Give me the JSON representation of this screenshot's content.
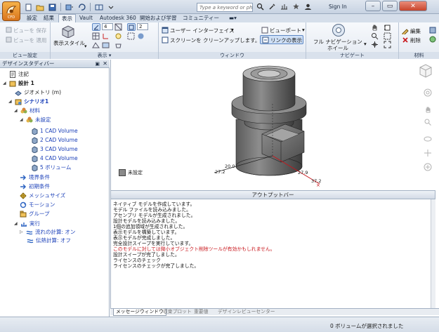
{
  "app": {
    "badge": "CFD",
    "search_placeholder": "Type a keyword or phrase",
    "signin": "Sign In",
    "window_controls": [
      "minimize",
      "maximize",
      "close"
    ]
  },
  "tabs": [
    "設定",
    "結果",
    "表示",
    "Vault",
    "Autodesk 360",
    "開始および学習",
    "コミュニティー"
  ],
  "active_tab": "表示",
  "ribbon": {
    "view_settings": {
      "label": "ビュー設定",
      "save_view": "ビューを 保存",
      "apply_view": "ビューを 適用"
    },
    "display": {
      "label": "表示",
      "display_style": "表示スタイル",
      "spin_value_1": "4",
      "spin_value_2": "2"
    },
    "window": {
      "label": "ウィンドウ",
      "user_interface": "ユーザー インターフェイス",
      "clean_screen": "スクリーンを クリーンアップします。",
      "viewport": "ビューポート",
      "link_display": "リンクの表示"
    },
    "navigate": {
      "label": "ナビゲート",
      "full_nav_wheel_line1": "フル ナビゲーション",
      "full_nav_wheel_line2": "ホイール"
    },
    "materials": {
      "label": "材料",
      "edit": "編集",
      "delete": "削除"
    }
  },
  "design_study_bar": {
    "title": "デザインスタディバー",
    "tree": [
      {
        "label": "注記",
        "level": 0,
        "icon": "note-icon"
      },
      {
        "label": "設計 1",
        "level": 0,
        "icon": "design-icon",
        "bold": true
      },
      {
        "label": "ジオメトリ (m)",
        "level": 1,
        "icon": "geometry-icon"
      },
      {
        "label": "シナリオ1",
        "level": 1,
        "icon": "scenario-icon",
        "bold": true,
        "blue": true
      },
      {
        "label": "材料",
        "level": 2,
        "icon": "material-icon",
        "blue": true
      },
      {
        "label": "未設定",
        "level": 3,
        "icon": "unset-icon",
        "blue": true
      },
      {
        "label": "1 CAD Volume",
        "level": 4,
        "icon": "volume-icon",
        "blue": true
      },
      {
        "label": "2 CAD Volume",
        "level": 4,
        "icon": "volume-icon",
        "blue": true
      },
      {
        "label": "3 CAD Volume",
        "level": 4,
        "icon": "volume-icon",
        "blue": true
      },
      {
        "label": "4 CAD Volume",
        "level": 4,
        "icon": "volume-icon",
        "blue": true
      },
      {
        "label": "5 ボリューム",
        "level": 4,
        "icon": "volume-icon",
        "blue": true
      },
      {
        "label": "境界条件",
        "level": 2,
        "icon": "boundary-icon",
        "blue": true
      },
      {
        "label": "初期条件",
        "level": 2,
        "icon": "initial-icon",
        "blue": true
      },
      {
        "label": "メッシュサイズ",
        "level": 2,
        "icon": "mesh-icon",
        "blue": true
      },
      {
        "label": "モーション",
        "level": 2,
        "icon": "motion-icon",
        "blue": true
      },
      {
        "label": "グループ",
        "level": 2,
        "icon": "group-icon",
        "blue": true
      },
      {
        "label": "実行",
        "level": 2,
        "icon": "run-icon",
        "blue": true
      },
      {
        "label": "流れの計算: オン",
        "level": 3,
        "icon": "flow-icon",
        "blue": true
      },
      {
        "label": "伝熱計算: オフ",
        "level": 3,
        "icon": "heat-icon",
        "blue": true
      }
    ]
  },
  "viewport": {
    "legend_label": "未設定",
    "dims": [
      "20.0",
      "27.2",
      "27.9",
      "37.2"
    ]
  },
  "output_bar": {
    "title": "アウトプットバー",
    "messages": [
      {
        "text": "ネイティブ モデルを作成しています。",
        "warn": false
      },
      {
        "text": "モデル ファイルを読み込みました。",
        "warn": false
      },
      {
        "text": "アセンブリ モデルが生成されました。",
        "warn": false
      },
      {
        "text": "設計モデルを読み込みました。",
        "warn": false
      },
      {
        "text": "1個の追加領域が生成されました。",
        "warn": false
      },
      {
        "text": "表示モデルを構築しています。",
        "warn": false
      },
      {
        "text": "表示モデルが完成しました。",
        "warn": false
      },
      {
        "text": "完全設計スイープを実行しています。",
        "warn": false
      },
      {
        "text": "このモデルに対しては微小オブジェクト削除ツールが有効かもしれません。",
        "warn": true
      },
      {
        "text": "設計スイープが完了しました。",
        "warn": false
      },
      {
        "text": "ライセンスのチェック",
        "warn": false
      },
      {
        "text": "ライセンスのチェックが完了しました。",
        "warn": false
      }
    ]
  },
  "bottom_tabs": [
    "メッセージウィンドウ",
    "収束プロット",
    "重要値",
    "デザインレビューセンター"
  ],
  "status": "0 ボリュームが選択されました"
}
